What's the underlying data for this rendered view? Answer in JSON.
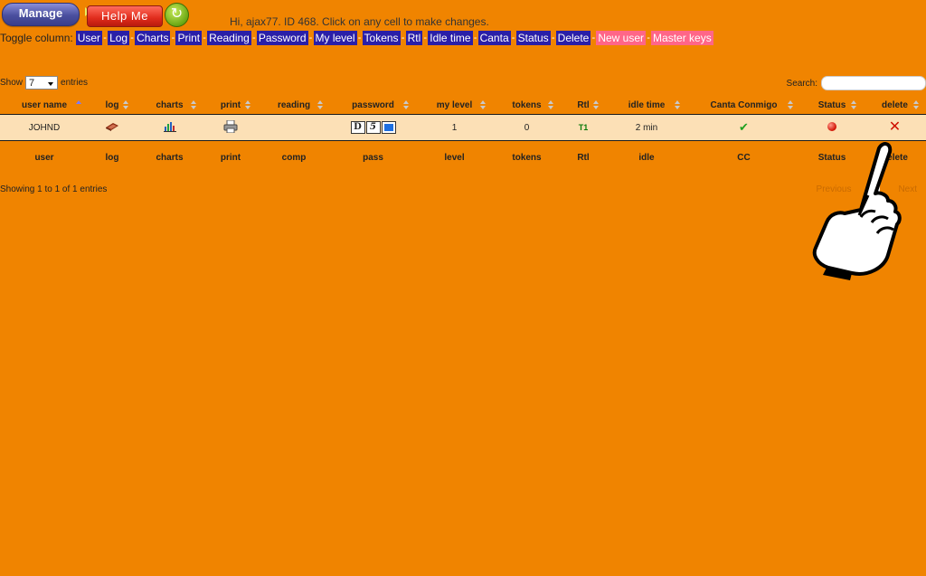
{
  "header": {
    "manage_label": "Manage",
    "help_label": "Help Me",
    "refresh_icon": "refresh-icon",
    "greeting": "Hi, ajax77. ID 468. Click on any cell to make changes."
  },
  "toggle": {
    "label": "Toggle column:",
    "columns": [
      "User",
      "Log",
      "Charts",
      "Print",
      "Reading",
      "Password",
      "My level",
      "Tokens",
      "Rtl",
      "Idle time",
      "Canta",
      "Status",
      "Delete"
    ],
    "extras": [
      "New user",
      "Master keys"
    ]
  },
  "controls": {
    "show_label": "Show",
    "entries_value": "7",
    "entries_label": "entries",
    "search_label": "Search:"
  },
  "table": {
    "headers": [
      "user name",
      "log",
      "charts",
      "print",
      "reading",
      "password",
      "my level",
      "tokens",
      "Rtl",
      "idle time",
      "Canta Conmigo",
      "Status",
      "delete"
    ],
    "row": {
      "user": "JOHND",
      "password_chars": [
        "D",
        "5"
      ],
      "level": "1",
      "tokens": "0",
      "rtl": "T1",
      "idle": "2 min"
    },
    "footers": [
      "user",
      "log",
      "charts",
      "print",
      "comp",
      "pass",
      "level",
      "tokens",
      "Rtl",
      "idle",
      "CC",
      "Status",
      "delete"
    ]
  },
  "info": "Showing 1 to 1 of 1 entries",
  "pager": {
    "previous": "Previous",
    "next": "Next"
  },
  "colors": {
    "background": "#f08400",
    "toggle_bg": "#2a1fa8",
    "toggle_pink": "#ff6688"
  }
}
